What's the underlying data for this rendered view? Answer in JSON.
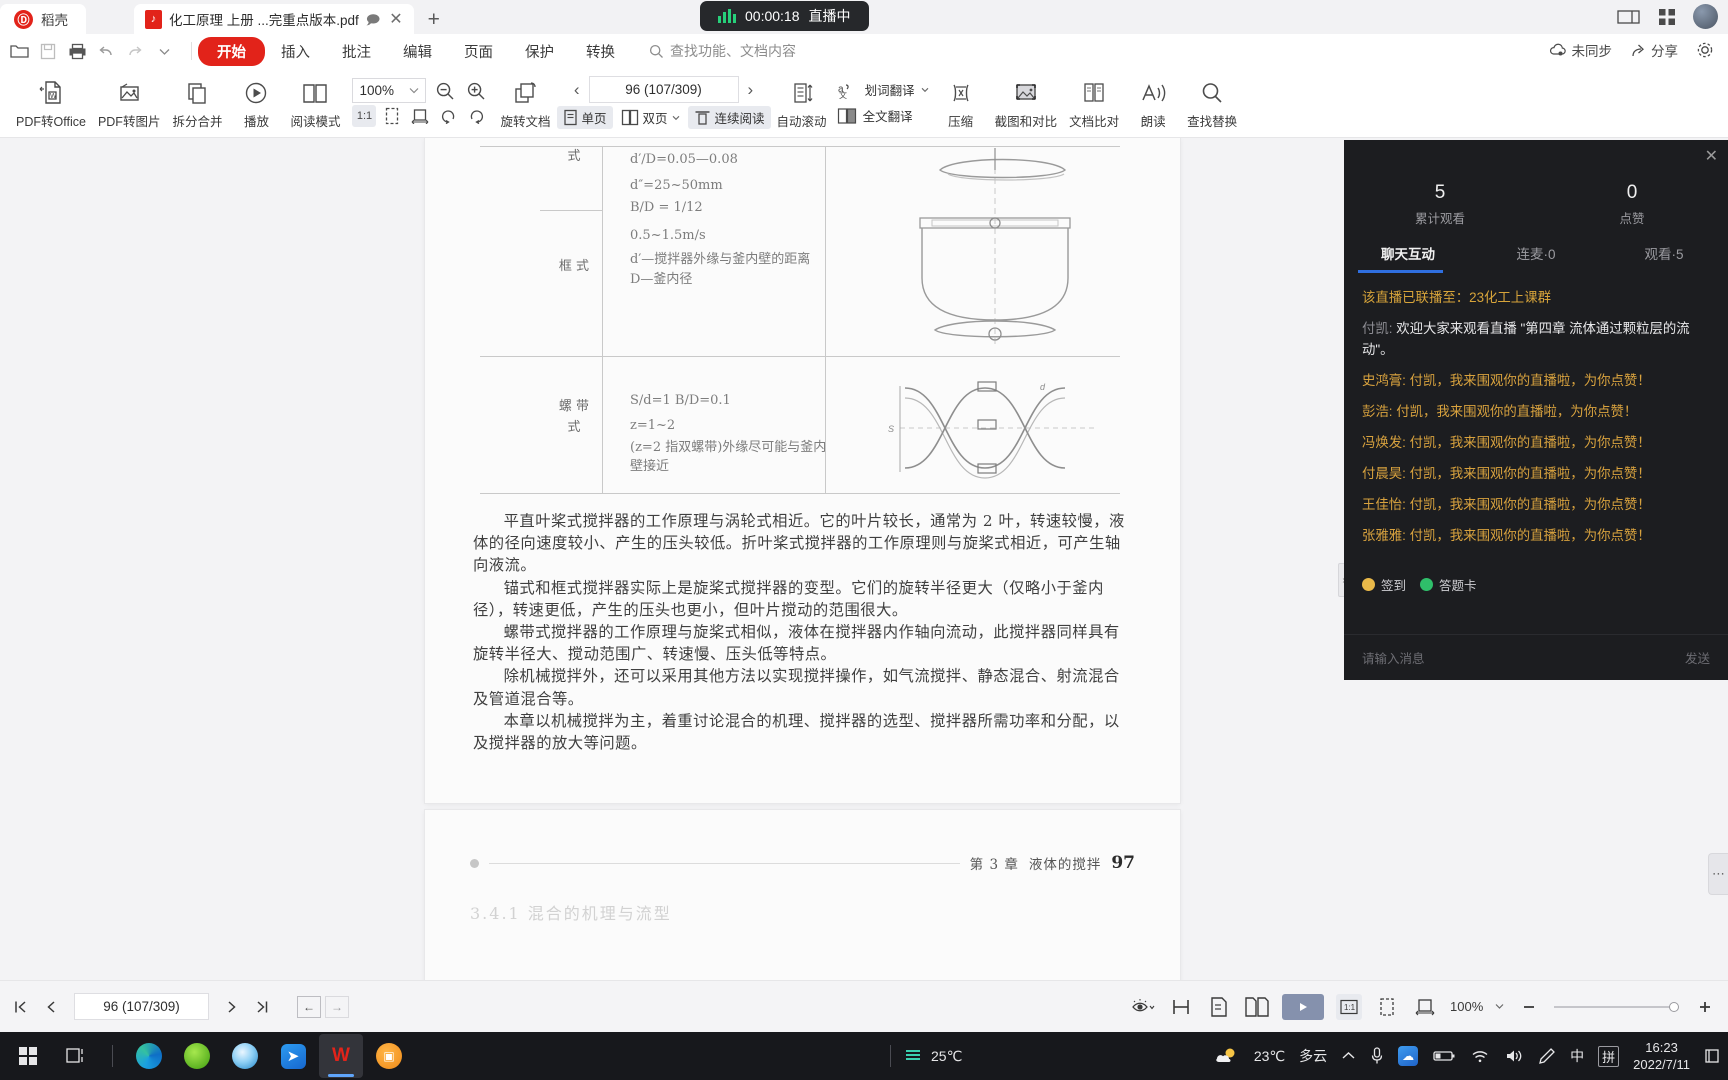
{
  "titlebar": {
    "brand": "稻壳",
    "tab_title": "化工原理  上册 ...完重点版本.pdf",
    "tab_new_label": "+",
    "live_time": "00:00:18",
    "live_label": "直播中"
  },
  "menubar": {
    "items": [
      "开始",
      "插入",
      "批注",
      "编辑",
      "页面",
      "保护",
      "转换"
    ],
    "active": "开始",
    "search_placeholder": "查找功能、文档内容",
    "sync_label": "未同步",
    "share_label": "分享"
  },
  "ribbon": {
    "buttons": [
      {
        "label": "PDF转Office",
        "icon": "pdf-to-office-icon",
        "caret": true
      },
      {
        "label": "PDF转图片",
        "icon": "pdf-to-image-icon",
        "caret": false
      },
      {
        "label": "拆分合并",
        "icon": "split-merge-icon",
        "caret": true
      },
      {
        "label": "播放",
        "icon": "play-icon",
        "caret": false
      },
      {
        "label": "阅读模式",
        "icon": "read-mode-icon",
        "caret": false
      }
    ],
    "zoom_value": "100%",
    "fit_buttons": [
      "1:1",
      "适合页面",
      "适合宽度",
      "逆时针旋转",
      "顺时针旋转"
    ],
    "rotate_doc_label": "旋转文档",
    "page_field": "96 (107/309)",
    "page_modes": [
      {
        "label": "单页",
        "selected": true
      },
      {
        "label": "双页",
        "selected": false
      },
      {
        "label": "连续阅读",
        "selected": true
      }
    ],
    "autoscroll_label": "自动滚动",
    "translate_word_label": "划词翻译",
    "translate_full_label": "全文翻译",
    "right_tools": [
      {
        "label": "压缩",
        "icon": "compress-icon"
      },
      {
        "label": "截图和对比",
        "icon": "screenshot-compare-icon"
      },
      {
        "label": "文档比对",
        "icon": "document-compare-icon"
      },
      {
        "label": "朗读",
        "icon": "read-aloud-icon"
      },
      {
        "label": "查找替换",
        "icon": "find-replace-icon"
      }
    ]
  },
  "document": {
    "table": {
      "row_labels": [
        "式",
        "框 式",
        "螺 带 式"
      ],
      "cells": [
        "d′/D=0.05—0.08",
        "d″=25~50mm",
        "B/D = 1/12",
        "0.5~1.5m/s",
        "d′—搅拌器外缘与釜内壁的距离",
        "D—釜内径",
        "S/d=1    B/D=0.1",
        "z=1~2",
        "(z=2 指双螺带)外缘尽可能与釜内壁接近"
      ]
    },
    "paragraphs": [
      "平直叶桨式搅拌器的工作原理与涡轮式相近。它的叶片较长，通常为 2 叶，转速较慢，液体的径向速度较小、产生的压头较低。折叶桨式搅拌器的工作原理则与旋桨式相近，可产生轴向液流。",
      "锚式和框式搅拌器实际上是旋桨式搅拌器的变型。它们的旋转半径更大（仅略小于釜内径），转速更低，产生的压头也更小，但叶片搅动的范围很大。",
      "螺带式搅拌器的工作原理与旋桨式相似，液体在搅拌器内作轴向流动，此搅拌器同样具有旋转半径大、搅动范围广、转速慢、压头低等特点。",
      "除机械搅拌外，还可以采用其他方法以实现搅拌操作，如气流搅拌、静态混合、射流混合及管道混合等。",
      "本章以机械搅拌为主，着重讨论混合的机理、搅拌器的选型、搅拌器所需功率和分配，以及搅拌器的放大等问题。"
    ],
    "footer_chapter": "第 3 章",
    "footer_section": "液体的搅拌",
    "footer_pagenum": "97",
    "next_page_heading": "3.4.1  混合的机理与流型"
  },
  "livechat": {
    "close_icon": "close-icon",
    "stats": [
      {
        "num": "5",
        "cap": "累计观看"
      },
      {
        "num": "0",
        "cap": "点赞"
      }
    ],
    "tabs": [
      {
        "label": "聊天互动",
        "active": true
      },
      {
        "label": "连麦·0",
        "active": false
      },
      {
        "label": "观看·5",
        "active": false
      }
    ],
    "messages": [
      {
        "type": "system",
        "text": "该直播已联播至：23化工上课群"
      },
      {
        "type": "chat",
        "name": "付凯",
        "text": "欢迎大家来观看直播 \"第四章 流体通过颗粒层的流动\"。"
      },
      {
        "type": "gold",
        "name": "史鸿膏",
        "text": "付凯，我来围观你的直播啦，为你点赞！"
      },
      {
        "type": "gold",
        "name": "彭浩",
        "text": "付凯，我来围观你的直播啦，为你点赞！"
      },
      {
        "type": "gold",
        "name": "冯焕发",
        "text": "付凯，我来围观你的直播啦，为你点赞！"
      },
      {
        "type": "gold",
        "name": "付晨昊",
        "text": "付凯，我来围观你的直播啦，为你点赞！"
      },
      {
        "type": "gold",
        "name": "王佳怡",
        "text": "付凯，我来围观你的直播啦，为你点赞！"
      },
      {
        "type": "gold",
        "name": "张雅雅",
        "text": "付凯，我来围观你的直播啦，为你点赞！"
      }
    ],
    "actions": [
      {
        "label": "签到",
        "color": "#e9b949"
      },
      {
        "label": "答题卡",
        "color": "#2fbf6a"
      }
    ],
    "input_placeholder": "请输入消息",
    "send_label": "发送"
  },
  "statusbar": {
    "page_field": "96 (107/309)",
    "zoom_value": "100%",
    "nav_first": "first-page-icon",
    "nav_prev": "prev-page-icon",
    "nav_next": "next-page-icon",
    "nav_last": "last-page-icon"
  },
  "taskbar": {
    "cpu_temp": "25℃",
    "weather_temp": "23℃",
    "weather_desc": "多云",
    "ime_lang": "中",
    "ime_mode": "拼",
    "time": "16:23",
    "date": "2022/7/11",
    "apps": [
      "start-icon",
      "search-icon",
      "task-view-icon",
      "edge-icon",
      "browser-green-icon",
      "ie-icon",
      "blue-app-icon",
      "wps-icon",
      "orange-app-icon"
    ]
  }
}
